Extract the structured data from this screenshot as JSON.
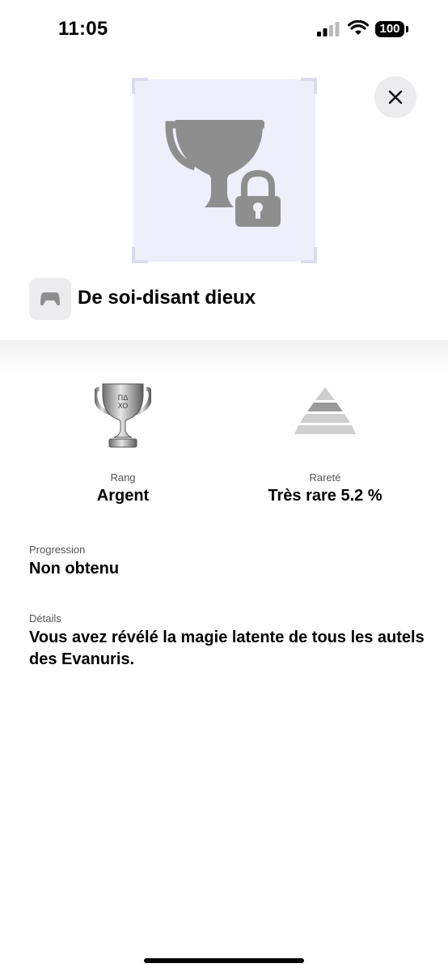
{
  "status_bar": {
    "time": "11:05",
    "battery": "100"
  },
  "close_button": {
    "icon": "close-icon"
  },
  "trophy": {
    "image_icon": "locked-trophy-icon",
    "game_icon": "gamepad-icon",
    "title": "De soi-disant dieux"
  },
  "stats": {
    "rank_label": "Rang",
    "rank_value": "Argent",
    "rank_icon": "silver-trophy-icon",
    "rarity_label": "Rareté",
    "rarity_value": "Très rare 5.2 %",
    "rarity_icon": "pyramid-icon"
  },
  "progression": {
    "label": "Progression",
    "value": "Non obtenu"
  },
  "details": {
    "label": "Détails",
    "value": "Vous avez révélé la magie latente de tous les autels des Evanuris."
  },
  "colors": {
    "frame_background": "#efeffb",
    "locked_icon_gray": "#8e8e8e",
    "button_background": "#ececef"
  }
}
